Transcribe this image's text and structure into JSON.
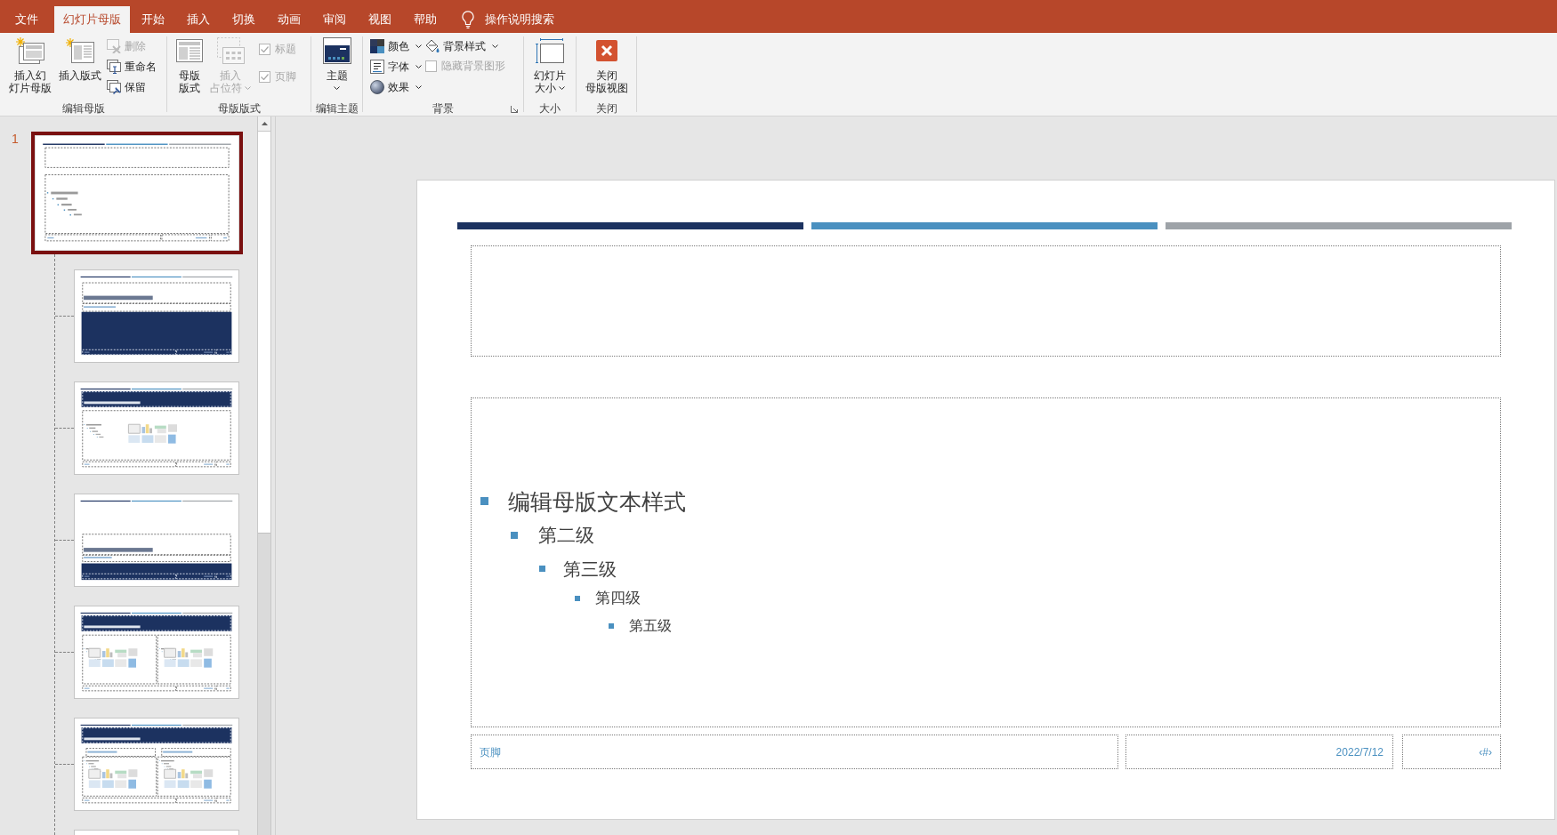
{
  "tabs": [
    {
      "label": "文件",
      "selected": false
    },
    {
      "label": "幻灯片母版",
      "selected": true
    },
    {
      "label": "开始",
      "selected": false
    },
    {
      "label": "插入",
      "selected": false
    },
    {
      "label": "切换",
      "selected": false
    },
    {
      "label": "动画",
      "selected": false
    },
    {
      "label": "审阅",
      "selected": false
    },
    {
      "label": "视图",
      "selected": false
    },
    {
      "label": "帮助",
      "selected": false
    }
  ],
  "tell_me": {
    "label": "操作说明搜索"
  },
  "ribbon": {
    "groups": [
      {
        "label": "编辑母版",
        "controls": [
          {
            "kind": "large",
            "lines": [
              "插入幻",
              "灯片母版"
            ],
            "disabled": false,
            "dropdown": false
          },
          {
            "kind": "large",
            "lines": [
              "插入版式"
            ],
            "disabled": false,
            "dropdown": false
          },
          {
            "kind": "stack",
            "items": [
              {
                "kind": "small",
                "label": "删除",
                "disabled": true,
                "dropdown": false
              },
              {
                "kind": "small",
                "label": "重命名",
                "disabled": false,
                "dropdown": false
              },
              {
                "kind": "small",
                "label": "保留",
                "disabled": false,
                "dropdown": false
              }
            ]
          }
        ]
      },
      {
        "label": "母版版式",
        "controls": [
          {
            "kind": "large",
            "lines": [
              "母版",
              "版式"
            ],
            "disabled": false,
            "dropdown": false
          },
          {
            "kind": "large",
            "lines": [
              "插入",
              "占位符"
            ],
            "disabled": true,
            "dropdown": true
          },
          {
            "kind": "spread",
            "items": [
              {
                "kind": "checkbox",
                "label": "标题",
                "checked": true,
                "disabled": true
              },
              {
                "kind": "checkbox",
                "label": "页脚",
                "checked": true,
                "disabled": true
              }
            ]
          }
        ]
      },
      {
        "label": "编辑主题",
        "controls": [
          {
            "kind": "large",
            "lines": [
              "主题"
            ],
            "disabled": false,
            "dropdown": true
          }
        ]
      },
      {
        "label": "背景",
        "launcher": true,
        "controls": [
          {
            "kind": "stack",
            "items": [
              {
                "kind": "small",
                "label": "颜色",
                "disabled": false,
                "dropdown": true
              },
              {
                "kind": "small",
                "label": "字体",
                "disabled": false,
                "dropdown": true
              },
              {
                "kind": "small",
                "label": "效果",
                "disabled": false,
                "dropdown": true
              }
            ]
          },
          {
            "kind": "stack",
            "items": [
              {
                "kind": "small",
                "label": "背景样式",
                "disabled": false,
                "dropdown": true
              },
              {
                "kind": "checkbox",
                "label": "隐藏背景图形",
                "checked": false,
                "disabled": true
              }
            ]
          }
        ]
      },
      {
        "label": "大小",
        "controls": [
          {
            "kind": "large",
            "lines": [
              "幻灯片",
              "大小"
            ],
            "disabled": false,
            "dropdown": true
          }
        ]
      },
      {
        "label": "关闭",
        "controls": [
          {
            "kind": "large",
            "lines": [
              "关闭",
              "母版视图"
            ],
            "disabled": false,
            "dropdown": false
          }
        ]
      }
    ]
  },
  "slide_panel": {
    "thumbnails": [
      {
        "kind": "master",
        "number": "1",
        "selected": true
      },
      {
        "kind": "title",
        "selected": false
      },
      {
        "kind": "content",
        "selected": false
      },
      {
        "kind": "section",
        "selected": false
      },
      {
        "kind": "two_content",
        "selected": false
      },
      {
        "kind": "comparison",
        "selected": false
      },
      {
        "kind": "partial",
        "selected": false
      }
    ]
  },
  "slide": {
    "body_outline": [
      {
        "text": "编辑母版文本样式",
        "children": [
          {
            "text": "第二级",
            "children": [
              {
                "text": "第三级",
                "children": [
                  {
                    "text": "第四级",
                    "children": [
                      {
                        "text": "第五级"
                      }
                    ]
                  }
                ]
              }
            ]
          }
        ]
      }
    ],
    "footer": "页脚",
    "date": "2022/7/12",
    "slide_number": "‹#›"
  }
}
